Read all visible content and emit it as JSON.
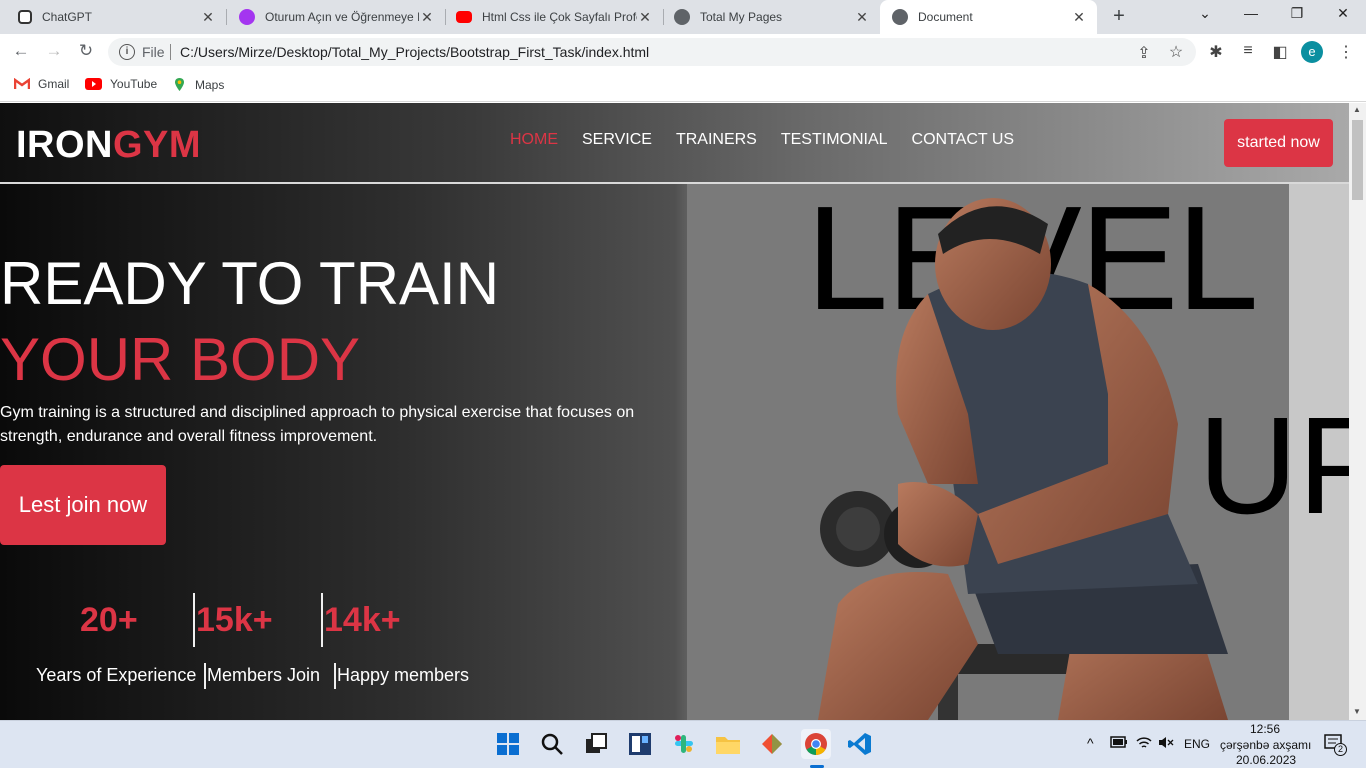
{
  "browser": {
    "tabs": [
      {
        "title": "ChatGPT",
        "icon": "chatgpt-icon",
        "active": false
      },
      {
        "title": "Oturum Açın ve Öğrenmeye Başlayın",
        "icon": "udemy-icon",
        "active": false
      },
      {
        "title": "Html Css ile Çok Sayfalı Profesyonel",
        "icon": "youtube-icon",
        "active": false
      },
      {
        "title": "Total My Pages",
        "icon": "globe-icon",
        "active": false
      },
      {
        "title": "Document",
        "icon": "globe-icon",
        "active": true
      }
    ],
    "address": {
      "scheme_label": "File",
      "url": "C:/Users/Mirze/Desktop/Total_My_Projects/Bootstrap_First_Task/index.html"
    },
    "profile_initial": "e",
    "bookmarks": [
      {
        "label": "Gmail",
        "icon": "gmail-icon"
      },
      {
        "label": "YouTube",
        "icon": "youtube-icon"
      },
      {
        "label": "Maps",
        "icon": "maps-icon"
      }
    ]
  },
  "page": {
    "brand": {
      "part1": "IRON",
      "part2": "GYM"
    },
    "nav": [
      {
        "label": "HOME",
        "active": true
      },
      {
        "label": "SERVICE",
        "active": false
      },
      {
        "label": "TRAINERS",
        "active": false
      },
      {
        "label": "TESTIMONIAL",
        "active": false
      },
      {
        "label": "CONTACT US",
        "active": false
      }
    ],
    "header_button": "started now",
    "background_text": {
      "line1": "LEVEL",
      "line2": "UP"
    },
    "hero": {
      "headline_white": "READY TO TRAIN",
      "headline_red": "YOUR BODY",
      "description": "Gym training is a structured and disciplined approach to physical exercise that focuses on strength, endurance and overall fitness improvement.",
      "cta": "Lest join now"
    },
    "stats": [
      {
        "value": "20+",
        "label": "Years of Experience"
      },
      {
        "value": "15k+",
        "label": "Members Join"
      },
      {
        "value": "14k+",
        "label": "Happy members"
      }
    ],
    "accent_color": "#dc3545"
  },
  "taskbar": {
    "apps": [
      "windows-start-icon",
      "search-icon",
      "task-view-icon",
      "widgets-icon",
      "slack-icon",
      "file-explorer-icon",
      "git-icon",
      "chrome-icon",
      "vscode-icon"
    ],
    "language": "ENG",
    "time": "12:56",
    "day": "çərşənbə axşamı",
    "date": "20.06.2023",
    "notification_count": "2"
  }
}
